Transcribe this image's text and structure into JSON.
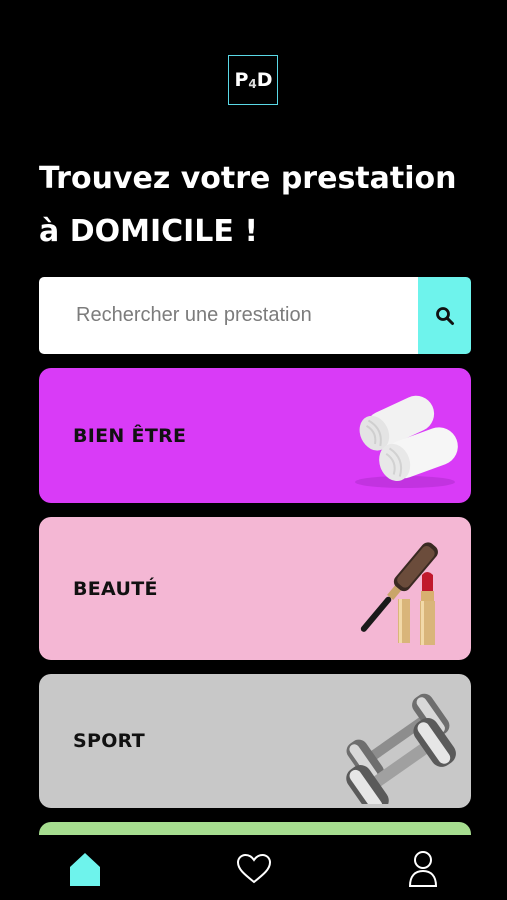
{
  "logo": {
    "left": "P",
    "mid": "4",
    "right": "D"
  },
  "headline": {
    "line1": "Trouvez votre prestation",
    "line2": "à DOMICILE !"
  },
  "search": {
    "placeholder": "Rechercher une prestation",
    "button_icon": "search-icon"
  },
  "categories": [
    {
      "label": "BIEN ÊTRE",
      "color": "#d93bf7",
      "icon": "towels-icon"
    },
    {
      "label": "BEAUTÉ",
      "color": "#f4b7d4",
      "icon": "brush-lipstick-icon"
    },
    {
      "label": "SPORT",
      "color": "#c8c8c8",
      "icon": "dumbbells-icon"
    },
    {
      "label": "",
      "color": "#a6dd8f",
      "icon": ""
    }
  ],
  "nav": {
    "items": [
      {
        "name": "home",
        "icon": "home-icon",
        "active": true,
        "color": "#6ef3ec"
      },
      {
        "name": "favorites",
        "icon": "heart-icon",
        "active": false
      },
      {
        "name": "profile",
        "icon": "user-icon",
        "active": false
      }
    ]
  }
}
